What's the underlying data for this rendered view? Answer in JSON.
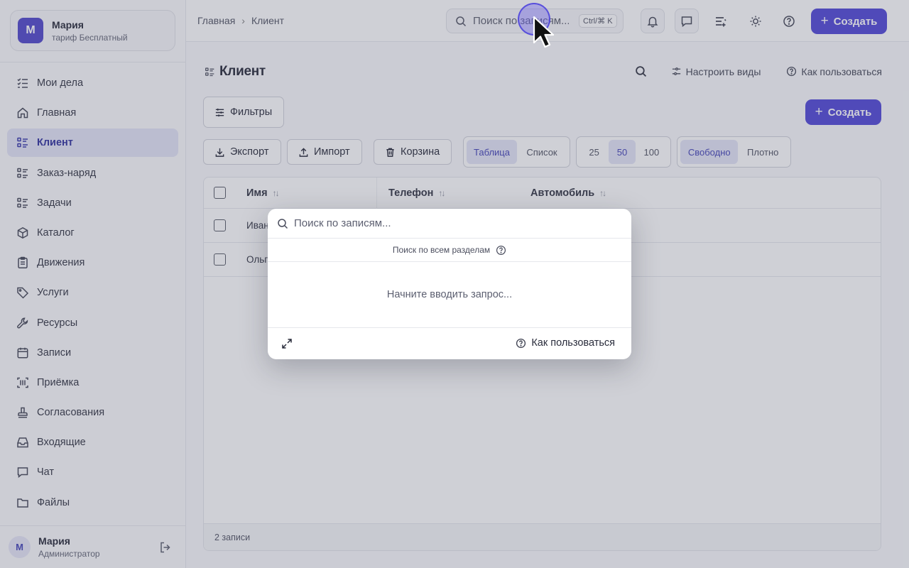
{
  "org": {
    "avatar_letter": "М",
    "name": "Мария",
    "plan": "тариф Бесплатный"
  },
  "sidebar": {
    "items": [
      {
        "label": "Мои дела",
        "icon": "checklist-icon"
      },
      {
        "label": "Главная",
        "icon": "home-icon"
      },
      {
        "label": "Клиент",
        "icon": "list-icon",
        "active": true
      },
      {
        "label": "Заказ-наряд",
        "icon": "list-icon"
      },
      {
        "label": "Задачи",
        "icon": "list-icon"
      },
      {
        "label": "Каталог",
        "icon": "box-icon"
      },
      {
        "label": "Движения",
        "icon": "clipboard-icon"
      },
      {
        "label": "Услуги",
        "icon": "tag-icon"
      },
      {
        "label": "Ресурсы",
        "icon": "wrench-icon"
      },
      {
        "label": "Записи",
        "icon": "calendar-icon"
      },
      {
        "label": "Приёмка",
        "icon": "scan-icon"
      },
      {
        "label": "Согласования",
        "icon": "stamp-icon"
      },
      {
        "label": "Входящие",
        "icon": "inbox-icon"
      },
      {
        "label": "Чат",
        "icon": "chat-icon"
      },
      {
        "label": "Файлы",
        "icon": "folder-icon"
      }
    ]
  },
  "user": {
    "avatar_letter": "М",
    "name": "Мария",
    "role": "Администратор"
  },
  "topbar": {
    "breadcrumb": [
      "Главная",
      "Клиент"
    ],
    "search_placeholder": "Поиск по записям...",
    "search_shortcut": "Ctrl/⌘ K",
    "create_label": "Создать"
  },
  "page": {
    "title": "Клиент",
    "configure_views": "Настроить виды",
    "how_to_use": "Как пользоваться",
    "filters": "Фильтры",
    "create_label": "Создать",
    "export": "Экспорт",
    "import": "Импорт",
    "trash": "Корзина",
    "view_modes": [
      "Таблица",
      "Список"
    ],
    "page_sizes": [
      "25",
      "50",
      "100"
    ],
    "densities": [
      "Свободно",
      "Плотно"
    ],
    "selected_view": "Таблица",
    "selected_page_size": "50",
    "selected_density": "Свободно"
  },
  "table": {
    "columns": [
      "Имя",
      "Телефон",
      "Автомобиль"
    ],
    "rows": [
      {
        "name": "Иван"
      },
      {
        "name": "Ольг"
      }
    ],
    "footer": "2 записи"
  },
  "search_modal": {
    "placeholder": "Поиск по записям...",
    "scope": "Поиск по всем разделам",
    "empty_state": "Начните вводить запрос...",
    "how_to_use": "Как пользоваться"
  },
  "colors": {
    "accent": "#4a3fd6",
    "active_bg": "#e3e4f6",
    "overlay": "rgba(95,100,118,0.30)"
  }
}
